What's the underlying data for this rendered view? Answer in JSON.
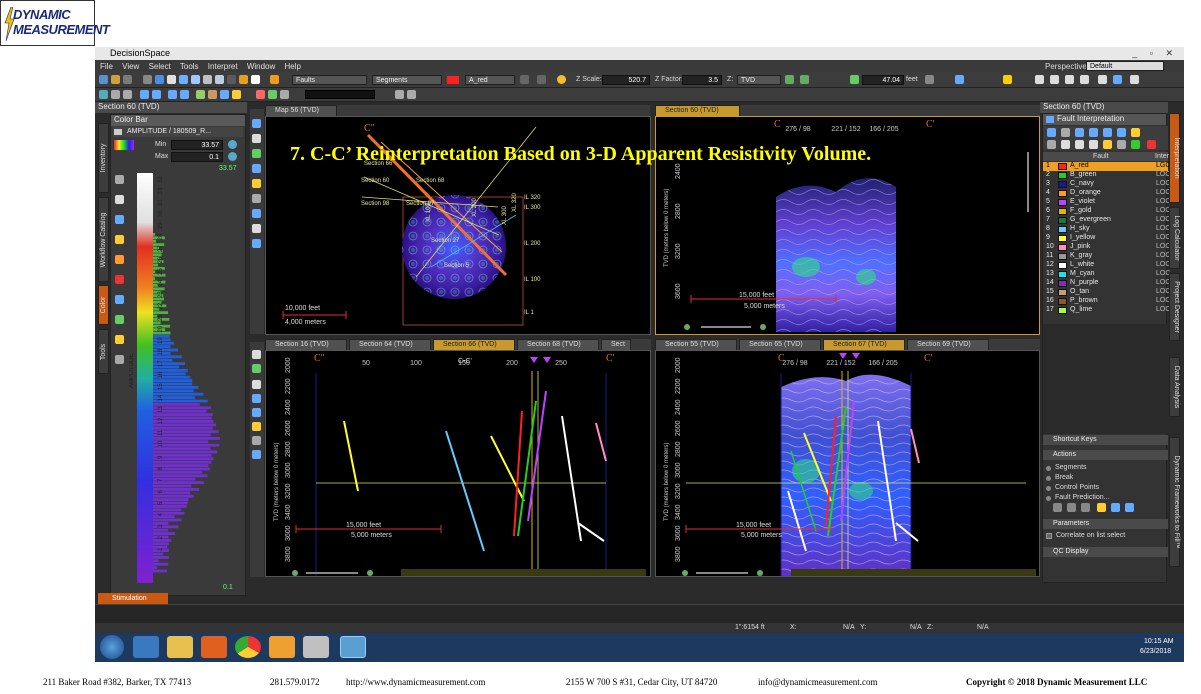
{
  "logo": {
    "line1": "DYNAMIC",
    "line2": "MEASUREMENT"
  },
  "window": {
    "title": "DecisionSpace",
    "perspective_label": "Perspective:",
    "perspective_value": "Default"
  },
  "menu": [
    "File",
    "View",
    "Select",
    "Tools",
    "Interpret",
    "Window",
    "Help"
  ],
  "toolbar": {
    "faults_combo": "Faults",
    "segments_combo": "Segments",
    "fault_name_combo": "A_red",
    "zscale_label": "Z Scale:",
    "zscale_value": "520.7",
    "zfactor_label": "Z Factor:",
    "zfactor_value": "3.5",
    "z_label": "Z:",
    "z_value": "TVD",
    "feet_value": "47.04",
    "feet_unit": "feet"
  },
  "left_panel": {
    "title": "Section 60 (TVD)",
    "colorbar_title": "Color Bar",
    "attribute": "AMPLITUDE / 180509_R...",
    "min_label": "Min",
    "min_value": "33.57",
    "max_label": "Max",
    "max_value": "0.1",
    "top_value": "33.57",
    "bottom_value": "0.1",
    "axis_label": "AMPLITUDE",
    "ticks": [
      "32",
      "33",
      "31",
      "30",
      "29",
      "28",
      "27",
      "26",
      "25",
      "24",
      "23",
      "22",
      "21",
      "20",
      "19",
      "18",
      "17",
      "16",
      "15",
      "14",
      "13",
      "12",
      "11",
      "10",
      "9",
      "8",
      "7",
      "6",
      "5",
      "4",
      "3",
      "2",
      "1"
    ],
    "vtabs": [
      "Inventory",
      "Workflow Catalog",
      "Color",
      "Tools"
    ]
  },
  "map_view": {
    "tab": "Map 56 (TVD)",
    "c_left": "C\"",
    "labels": [
      "Section 66",
      "Section 60",
      "Section 98",
      "Section 68",
      "Section 97",
      "Section 27",
      "Section 5",
      "XL 100",
      "XL 200",
      "XL 300",
      "XL 320",
      "IL 320",
      "IL 300",
      "IL 200",
      "IL 100",
      "IL 1"
    ],
    "scale_feet": "10,000 feet",
    "scale_meters": "4,000 meters"
  },
  "section60_view": {
    "tab": "Section 60 (TVD)",
    "c_left": "C",
    "c_right": "C'",
    "top_ticks": [
      "276 / 98",
      "221 / 152",
      "166 / 205"
    ],
    "depth_ticks": [
      "2400",
      "2800",
      "3200",
      "3600"
    ],
    "y_label": "TVD (meters below 0 meters)",
    "scale_feet": "15,000 feet",
    "scale_meters": "5,000 meters"
  },
  "section66_view": {
    "tabs": [
      "Section 16 (TVD)",
      "Section 64 (TVD)",
      "Section 66 (TVD)",
      "Section 68 (TVD)",
      "Sect"
    ],
    "active_tab": 2,
    "c_left": "C\"",
    "c_right": "C'",
    "top_ticks": [
      "50",
      "100",
      "150",
      "200",
      "250"
    ],
    "center_label": "C-C'",
    "depth_ticks": [
      "2000",
      "2200",
      "2400",
      "2600",
      "2800",
      "3000",
      "3200",
      "3400",
      "3600",
      "3800"
    ],
    "y_label": "TVD (meters below 0 meters)",
    "scale_feet": "15,000 feet",
    "scale_meters": "5,000 meters"
  },
  "section67_view": {
    "tabs": [
      "Section 55 (TVD)",
      "Section 65 (TVD)",
      "Section 67 (TVD)",
      "Section 69 (TVD)"
    ],
    "active_tab": 2,
    "c_left": "C",
    "c_right": "C'",
    "top_ticks": [
      "276 / 98",
      "221 / 152",
      "166 / 205"
    ],
    "depth_ticks": [
      "2000",
      "2200",
      "2400",
      "2600",
      "2800",
      "3000",
      "3200",
      "3400",
      "3600",
      "3800"
    ],
    "y_label": "TVD (meters below 0 meters)",
    "scale_feet": "15,000 feet",
    "scale_meters": "5,000 meters"
  },
  "overlay_title": "7. C-C’ Reinterpretation  Based on 3-D Apparent Resistivity Volume.",
  "right_panel": {
    "title": "Section 60 (TVD)",
    "fault_title": "Fault Interpretation",
    "col_fault": "Fault",
    "col_inter": "Interp",
    "faults": [
      {
        "n": "1",
        "name": "A_red",
        "color": "#ff2020",
        "interp": "LGC"
      },
      {
        "n": "2",
        "name": "B_green",
        "color": "#20d020",
        "interp": "LOC"
      },
      {
        "n": "3",
        "name": "C_navy",
        "color": "#1a1a8c",
        "interp": "LOC"
      },
      {
        "n": "4",
        "name": "D_orange",
        "color": "#ff9a20",
        "interp": "LOC"
      },
      {
        "n": "5",
        "name": "E_violet",
        "color": "#c040ff",
        "interp": "LOC"
      },
      {
        "n": "6",
        "name": "F_gold",
        "color": "#e0b800",
        "interp": "LOC"
      },
      {
        "n": "7",
        "name": "G_evergreen",
        "color": "#117a3c",
        "interp": "LOC"
      },
      {
        "n": "8",
        "name": "H_sky",
        "color": "#66ccff",
        "interp": "LOC"
      },
      {
        "n": "9",
        "name": "I_yellow",
        "color": "#ffff30",
        "interp": "LOC"
      },
      {
        "n": "10",
        "name": "J_pink",
        "color": "#ff90c0",
        "interp": "LOC"
      },
      {
        "n": "11",
        "name": "K_gray",
        "color": "#9a9a9a",
        "interp": "LOC"
      },
      {
        "n": "12",
        "name": "L_white",
        "color": "#ffffff",
        "interp": "LOC"
      },
      {
        "n": "13",
        "name": "M_cyan",
        "color": "#20e0e0",
        "interp": "LOC"
      },
      {
        "n": "14",
        "name": "N_purple",
        "color": "#8030b0",
        "interp": "LOC"
      },
      {
        "n": "15",
        "name": "O_tan",
        "color": "#c8a070",
        "interp": "LOC"
      },
      {
        "n": "16",
        "name": "P_brown",
        "color": "#8a5a2a",
        "interp": "LOC"
      },
      {
        "n": "17",
        "name": "Q_lime",
        "color": "#a0ff40",
        "interp": "LOC"
      }
    ],
    "shortcut_keys": "Shortcut Keys",
    "actions_title": "Actions",
    "actions": [
      "Segments",
      "Break",
      "Control Points",
      "Fault Prediction..."
    ],
    "parameters_title": "Parameters",
    "correlate": "Correlate on list select",
    "qc_display": "QC Display",
    "vtabs": [
      "Interpretation",
      "Log Calculator",
      "Project Designer",
      "Data Analysis",
      "Dynamic Frameworks to Fill™"
    ]
  },
  "bottom": {
    "stimulation_tab": "Stimulation",
    "scale_readout": "1\":6154 ft",
    "x_label": "X:",
    "x_val": "N/A",
    "y_label": "Y:",
    "y_val": "N/A",
    "z_label": "Z:",
    "z_val": "N/A",
    "time": "10:15 AM",
    "date": "6/23/2018"
  },
  "footer": {
    "addr1": "211 Baker Road #382, Barker, TX 77413",
    "phone": "281.579.0172",
    "url": "http://www.dynamicmeasurement.com",
    "addr2": "2155 W 700 S #31, Cedar City, UT 84720",
    "email": "info@dynamicmeasurement.com",
    "copyright": "Copyright © 2018  Dynamic Measurement  LLC"
  }
}
